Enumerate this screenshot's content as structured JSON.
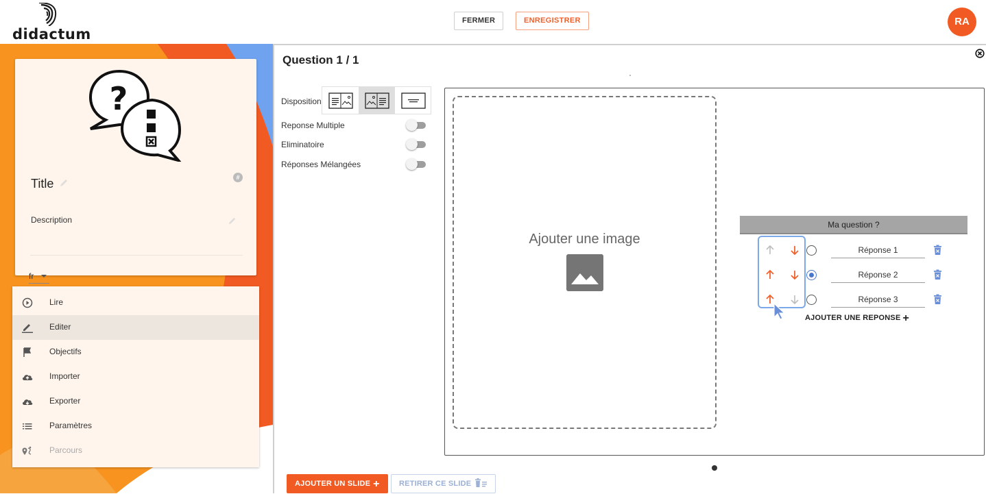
{
  "header": {
    "logo_text": "didactum",
    "close_label": "FERMER",
    "save_label": "ENREGISTRER",
    "avatar_initials": "RA"
  },
  "left_panel": {
    "card": {
      "title": "Title",
      "description": "Description",
      "language": "fr"
    },
    "menu": [
      {
        "label": "Lire",
        "icon": "play-circle-icon",
        "active": false,
        "disabled": false
      },
      {
        "label": "Editer",
        "icon": "pencil-icon",
        "active": true,
        "disabled": false
      },
      {
        "label": "Objectifs",
        "icon": "flag-icon",
        "active": false,
        "disabled": false
      },
      {
        "label": "Importer",
        "icon": "cloud-upload-icon",
        "active": false,
        "disabled": false
      },
      {
        "label": "Exporter",
        "icon": "cloud-download-icon",
        "active": false,
        "disabled": false
      },
      {
        "label": "Paramètres",
        "icon": "list-icon",
        "active": false,
        "disabled": false
      },
      {
        "label": "Parcours",
        "icon": "route-icon",
        "active": false,
        "disabled": true
      }
    ]
  },
  "editor": {
    "question_title": "Question 1 / 1",
    "disposition_label": "Disposition",
    "selected_layout": 1,
    "toggles": [
      {
        "label": "Reponse Multiple",
        "on": false
      },
      {
        "label": "Eliminatoire",
        "on": false
      },
      {
        "label": "Réponses Mélangées",
        "on": false
      }
    ],
    "image_placeholder": "Ajouter une image",
    "question": {
      "header": "Ma question ?",
      "answers": [
        {
          "label": "Réponse 1",
          "up_enabled": false,
          "down_enabled": true,
          "selected": false
        },
        {
          "label": "Réponse 2",
          "up_enabled": true,
          "down_enabled": true,
          "selected": true
        },
        {
          "label": "Réponse 3",
          "up_enabled": true,
          "down_enabled": false,
          "selected": false
        }
      ],
      "add_answer_label": "AJOUTER UNE REPONSE"
    },
    "add_slide_label": "AJOUTER UN SLIDE",
    "remove_slide_label": "RETIRER CE SLIDE"
  },
  "colors": {
    "accent": "#f15a22",
    "arrow_active": "#f0612c",
    "arrow_disabled": "#bdbdbd",
    "highlight": "#7aa8e8",
    "radio_selected": "#4a78c8"
  }
}
